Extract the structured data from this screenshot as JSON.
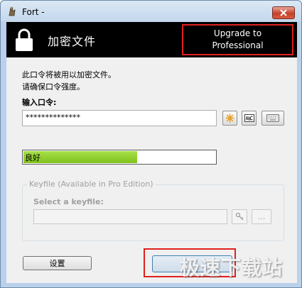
{
  "window": {
    "title": "Fort -"
  },
  "banner": {
    "title": "加密文件",
    "upgrade_line1": "Upgrade to",
    "upgrade_line2": "Professional"
  },
  "content": {
    "info_line1": "此口令将被用以加密文件。",
    "info_line2": "请确保口令强度。",
    "password_label": "输入口令:",
    "password_value": "**************",
    "strength_text": "良好",
    "strength_fraction": 0.59
  },
  "keyfile": {
    "legend": "Keyfile (Available in Pro Edition)",
    "label": "Select a keyfile:",
    "browse_label": "..."
  },
  "buttons": {
    "settings_label": "设置",
    "main_label": ""
  },
  "watermark": {
    "text": "极速下载站"
  },
  "icons": {
    "app": "fort-app-icon",
    "close": "close-icon",
    "lock": "lock-icon",
    "generate": "star-icon",
    "show_chars": "abc-icon",
    "keyboard": "keyboard-icon",
    "find_key": "key-find-icon"
  },
  "colors": {
    "accent_red": "#e0201e",
    "strength_green": "#7fc21b"
  }
}
